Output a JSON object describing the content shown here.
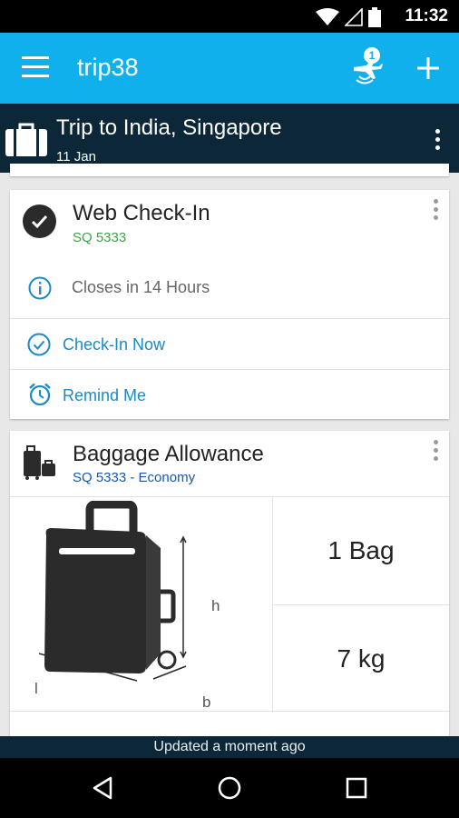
{
  "status_bar": {
    "time": "11:32"
  },
  "app_bar": {
    "title": "trip38",
    "notification_count": "1"
  },
  "trip": {
    "title": "Trip to India, Singapore",
    "date": "11 Jan"
  },
  "checkin_card": {
    "title": "Web Check-In",
    "flight": "SQ 5333",
    "closes_text": "Closes in 14 Hours",
    "checkin_now": "Check-In Now",
    "remind_me": "Remind Me"
  },
  "baggage_card": {
    "title": "Baggage Allowance",
    "subtitle": "SQ 5333 - Economy",
    "bag_count": "1 Bag",
    "weight": "7 kg",
    "dim_h": "h",
    "dim_l": "l",
    "dim_b": "b"
  },
  "footer": {
    "updated": "Updated a moment ago"
  },
  "colors": {
    "app_bar": "#10b0ec",
    "trip_header": "#0c2838",
    "link": "#1a8ac8",
    "flight_green": "#3aa544"
  },
  "icons": [
    "wifi-icon",
    "signal-icon",
    "battery-icon",
    "menu-icon",
    "flight-notification-icon",
    "plus-icon",
    "suitcase-icon",
    "more-vert-icon",
    "check-circle-icon",
    "info-icon",
    "check-outline-icon",
    "alarm-icon",
    "luggage-icon",
    "back-icon",
    "home-icon",
    "recents-icon"
  ]
}
